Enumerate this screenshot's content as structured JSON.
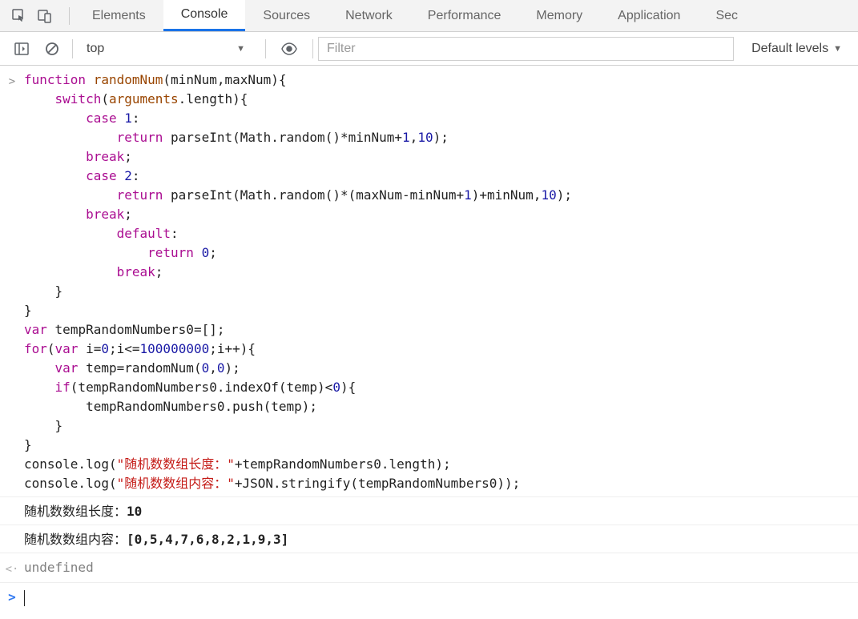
{
  "tabs": {
    "elements": "Elements",
    "console": "Console",
    "sources": "Sources",
    "network": "Network",
    "performance": "Performance",
    "memory": "Memory",
    "application": "Application",
    "security": "Sec"
  },
  "toolbar": {
    "context": "top",
    "filter_placeholder": "Filter",
    "levels": "Default levels"
  },
  "console": {
    "input_gutter": ">",
    "return_gutter": "<·",
    "prompt_gutter": ">",
    "code": {
      "l1_kw1": "function",
      "l1_fn": "randomNum",
      "l1_p1": "minNum",
      "l1_p2": "maxNum",
      "l2_kw": "switch",
      "l2_arg": "arguments",
      "l2_prop": "length",
      "l3_kw": "case",
      "l3_num": "1",
      "l4_kw": "return",
      "l4_fn": "parseInt(Math.random()*",
      "l4_a": "minNum",
      "l4_plus": "+",
      "l4_one": "1",
      "l4_c": ",",
      "l4_ten": "10",
      "l4_end": ");",
      "l5_kw": "break",
      "l6_kw": "case",
      "l6_num": "2",
      "l7_kw": "return",
      "l7_pre": "parseInt(Math.random()*(",
      "l7_max": "maxNum",
      "l7_minus": "-",
      "l7_min": "minNum",
      "l7_plus": "+",
      "l7_one": "1",
      "l7_close": ")+",
      "l7_min2": "minNum",
      "l7_c": ",",
      "l7_ten": "10",
      "l7_end": ");",
      "l8_kw": "break",
      "l9_kw": "default",
      "l10_kw": "return",
      "l10_num": "0",
      "l11_kw": "break",
      "l14_kw": "var",
      "l14_name": "tempRandomNumbers0=[];",
      "l15_kw1": "for",
      "l15_kw2": "var",
      "l15_i": "i=",
      "l15_z": "0",
      "l15_cond": ";i<=",
      "l15_big": "100000000",
      "l15_inc": ";i++){",
      "l16_kw": "var",
      "l16_rest": "temp=randomNum(",
      "l16_z1": "0",
      "l16_c": ",",
      "l16_z2": "0",
      "l16_end": ");",
      "l17_kw": "if",
      "l17_body": "(tempRandomNumbers0.indexOf(temp)<",
      "l17_z": "0",
      "l17_end": "){",
      "l18": "tempRandomNumbers0.push(temp);",
      "l21_pre": "console.log(",
      "l21_str": "\"随机数数组长度：\"",
      "l21_post": "+tempRandomNumbers0.length);",
      "l22_pre": "console.log(",
      "l22_str": "\"随机数数组内容：\"",
      "l22_post": "+JSON.stringify(tempRandomNumbers0));"
    },
    "output1_label": "随机数数组长度：",
    "output1_value": "10",
    "output2_label": "随机数数组内容：",
    "output2_value": "[0,5,4,7,6,8,2,1,9,3]",
    "return_value": "undefined"
  }
}
